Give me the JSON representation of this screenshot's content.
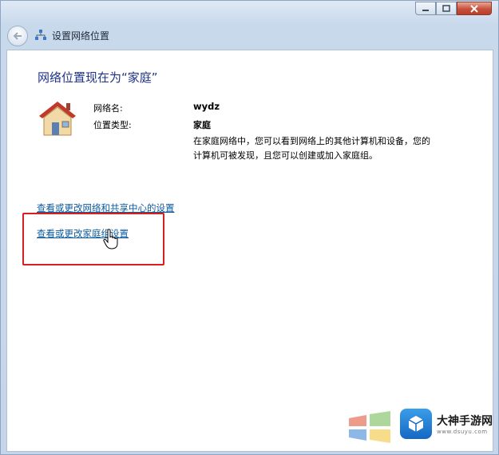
{
  "window": {
    "title": "设置网络位置",
    "caption_icons": [
      "minimize-icon",
      "maximize-icon",
      "close-icon"
    ]
  },
  "main": {
    "heading": "网络位置现在为“家庭”",
    "network_name_label": "网络名:",
    "network_name_value": "wydz",
    "location_type_label": "位置类型:",
    "location_type_value": "家庭",
    "description": "在家庭网络中，您可以看到网络上的其他计算机和设备，您的计算机可被发现，且您可以创建或加入家庭组。",
    "link_network_center": "查看或更改网络和共享中心的设置",
    "link_homegroup": "查看或更改家庭组设置"
  },
  "watermark": {
    "name": "大神手游网",
    "url": "www.dsuyu.com"
  },
  "colors": {
    "heading": "#1e3287",
    "link": "#0b5a9e",
    "highlight_box": "#d81e1e"
  }
}
